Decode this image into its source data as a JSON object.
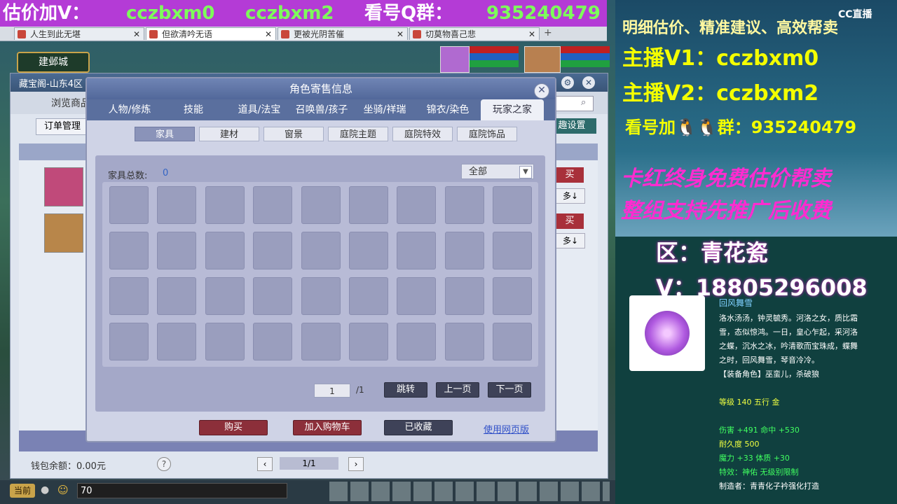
{
  "banner": {
    "t1": "估价加V：",
    "t2": "cczbxm0",
    "t3": "cczbxm2",
    "t4": "看号Q群：",
    "t5": "935240479"
  },
  "browser_tabs": [
    {
      "label": "人生到此无堪"
    },
    {
      "label": "但欲清吟无语"
    },
    {
      "label": "更被光阴苦催"
    },
    {
      "label": "切莫物喜己悲"
    }
  ],
  "game": {
    "location": "建邺城",
    "back_title": "藏宝阁-山东4区",
    "back_tab": "浏览商品",
    "order_mgmt": "订单管理",
    "interest": "趣设置",
    "buy_short": "买",
    "more": "多↓",
    "wallet": "钱包余额：0.00元",
    "help": "?",
    "page": "1/1",
    "chat_channel": "当前",
    "chat_input": "70"
  },
  "dialog": {
    "title": "角色寄售信息",
    "tabs": [
      "人物/修炼",
      "技能",
      "道具/法宝",
      "召唤兽/孩子",
      "坐骑/祥瑞",
      "锦衣/染色",
      "玩家之家"
    ],
    "subtabs": [
      "家具",
      "建材",
      "窗景",
      "庭院主题",
      "庭院特效",
      "庭院饰品"
    ],
    "count_label": "家具总数:",
    "count_value": "0",
    "filter": "全部",
    "page_current": "1",
    "page_total": "/1",
    "jump": "跳转",
    "prev": "上一页",
    "next": "下一页",
    "buy": "购买",
    "add_cart": "加入购物车",
    "favorited": "已收藏",
    "web_version": "使用网页版"
  },
  "right_panel": {
    "l1": "明细估价、精准建议、高效帮卖",
    "l2": "主播V1：cczbxm0",
    "l3": "主播V2：cczbxm2",
    "l4": "看号加🐧🐧群：935240479",
    "l5": "卡红终身免费估价帮卖",
    "l6": "整组支持先推广后收费",
    "l7": "区：青花瓷",
    "l8": "V：18805296008",
    "watermark": "CC直播",
    "item": {
      "name": "回风舞雪",
      "desc1": "洛水汤汤，钟灵毓秀。河洛之女，质比霜",
      "desc2": "雪，态似惊鸿。一日，皇心乍起，采河洛",
      "desc3": "之蝶，沉水之冰，吟清歌而宝珠成，蝶舞",
      "desc4": "之时，回风舞雪，琴音冷冷。",
      "role": "【装备角色】巫蛮儿，杀破狼",
      "level": "等级 140 五行 金",
      "dmg": "伤害 +491 命中 +530",
      "dur": "耐久度 500",
      "magic": "魔力 +33 体质 +30",
      "effect": "特效：神佑 无级别限制",
      "maker": "制造者：青青化子衿强化打造"
    }
  }
}
